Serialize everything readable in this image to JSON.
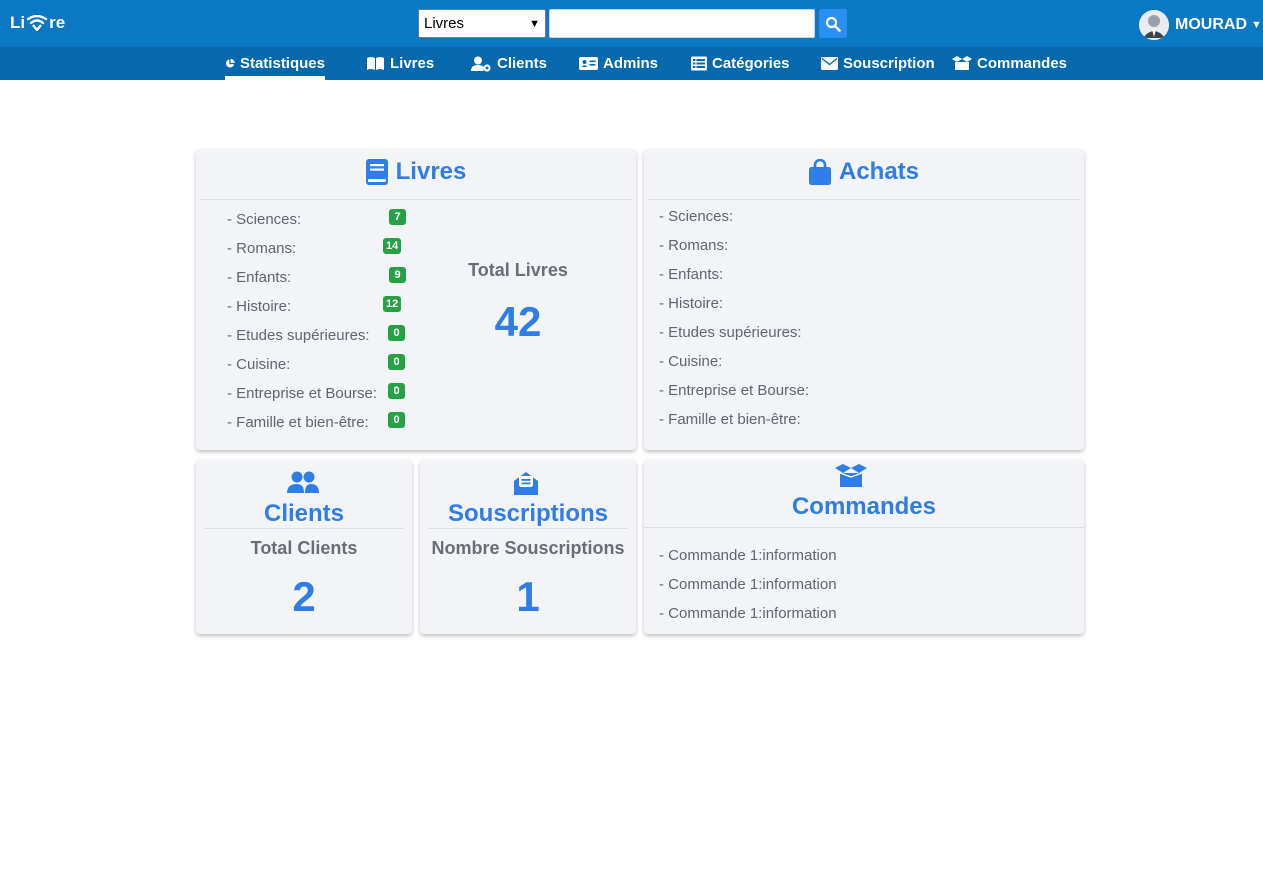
{
  "header": {
    "logo_left": "Li",
    "logo_right": "re",
    "search": {
      "category_value": "Livres",
      "query_value": "",
      "button_icon": "search-icon"
    },
    "user": {
      "name": "MOURAD",
      "avatar_icon": "user-avatar-icon"
    }
  },
  "nav": {
    "items": [
      {
        "label": "Statistiques",
        "icon": "pie-chart-icon",
        "active": true
      },
      {
        "label": "Livres",
        "icon": "open-book-icon"
      },
      {
        "label": "Clients",
        "icon": "user-gear-icon"
      },
      {
        "label": "Admins",
        "icon": "id-card-icon"
      },
      {
        "label": "Catégories",
        "icon": "list-icon"
      },
      {
        "label": "Souscription",
        "icon": "envelope-icon"
      },
      {
        "label": "Commandes",
        "icon": "box-open-icon"
      }
    ]
  },
  "livres_card": {
    "title": "Livres",
    "icon": "book-icon",
    "categories": [
      {
        "label": "- Sciences:",
        "count": "7"
      },
      {
        "label": "- Romans:",
        "count": "14"
      },
      {
        "label": "- Enfants:",
        "count": "9"
      },
      {
        "label": "- Histoire:",
        "count": "12"
      },
      {
        "label": "- Etudes supérieures:",
        "count": "0"
      },
      {
        "label": "- Cuisine:",
        "count": "0"
      },
      {
        "label": "- Entreprise et Bourse:",
        "count": "0"
      },
      {
        "label": "- Famille et bien-être:",
        "count": "0"
      }
    ],
    "total_label": "Total Livres",
    "total_value": "42"
  },
  "achats_card": {
    "title": "Achats",
    "icon": "shopping-bag-icon",
    "categories": [
      "- Sciences:",
      "- Romans:",
      "- Enfants:",
      "- Histoire:",
      "- Etudes supérieures:",
      "- Cuisine:",
      "- Entreprise et Bourse:",
      "- Famille et bien-être:"
    ]
  },
  "clients_card": {
    "title": "Clients",
    "icon": "users-icon",
    "total_label": "Total Clients",
    "total_value": "2"
  },
  "souscriptions_card": {
    "title": "Souscriptions",
    "icon": "envelope-open-icon",
    "total_label": "Nombre Souscriptions",
    "total_value": "1"
  },
  "commandes_card": {
    "title": "Commandes",
    "icon": "box-open-icon",
    "items": [
      "- Commande 1:information",
      "- Commande 1:information",
      "- Commande 1:information"
    ]
  },
  "colors": {
    "topbar": "#0a78c2",
    "navbar": "#0769ad",
    "accent": "#2f7de6",
    "badge": "#25a244",
    "card": "#f3f4f8"
  }
}
